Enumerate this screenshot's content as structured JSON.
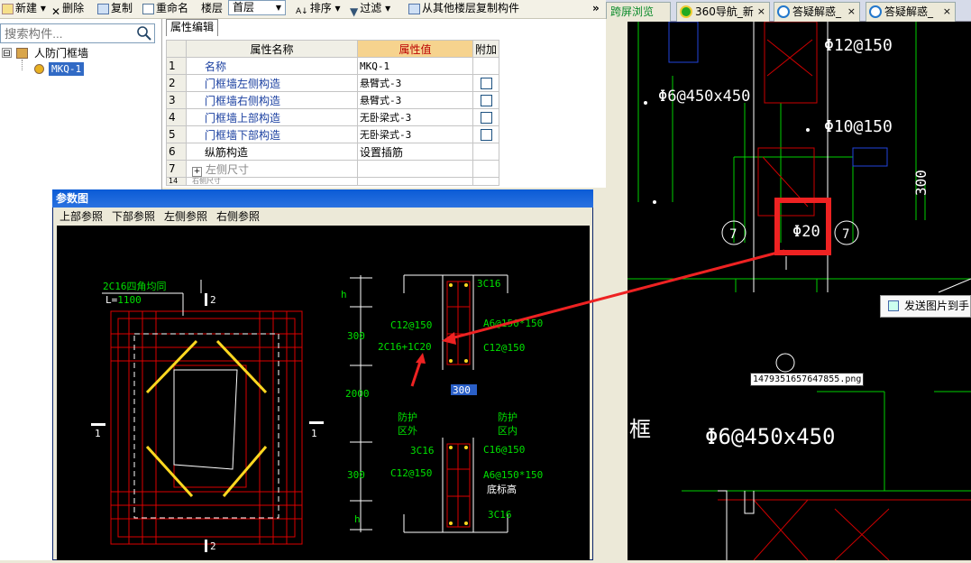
{
  "toolbar": {
    "new": "新建",
    "delete": "删除",
    "copy": "复制",
    "rename": "重命名",
    "floor_label": "楼层",
    "floor_value": "首层",
    "sort": "排序",
    "filter": "过滤",
    "copy_from_floor": "从其他楼层复制构件",
    "overflow": "»"
  },
  "tabs": [
    {
      "label": "跨屏浏览"
    },
    {
      "label": "360导航_新"
    },
    {
      "label": "答疑解惑_"
    },
    {
      "label": "答疑解惑_"
    }
  ],
  "tab_close": "×",
  "search": {
    "placeholder": "搜索构件..."
  },
  "tree": {
    "root": "人防门框墙",
    "child": "MKQ-1",
    "expand": "⊟"
  },
  "prop_panel": {
    "tab": "属性编辑",
    "headers": {
      "name": "属性名称",
      "value": "属性值",
      "extra": "附加"
    },
    "rows": [
      {
        "num": "1",
        "name": "名称",
        "value": "MKQ-1"
      },
      {
        "num": "2",
        "name": "门框墙左侧构造",
        "value": "悬臂式-3"
      },
      {
        "num": "3",
        "name": "门框墙右侧构造",
        "value": "悬臂式-3"
      },
      {
        "num": "4",
        "name": "门框墙上部构造",
        "value": "无卧梁式-3"
      },
      {
        "num": "5",
        "name": "门框墙下部构造",
        "value": "无卧梁式-3"
      },
      {
        "num": "6",
        "name": "纵筋构造",
        "value": "设置插筋"
      },
      {
        "num": "7",
        "name": "左侧尺寸",
        "value": ""
      },
      {
        "num": "14",
        "name": "右侧尺寸",
        "value": ""
      }
    ]
  },
  "dialog": {
    "title": "参数图",
    "menu": [
      "上部参照",
      "下部参照",
      "左侧参照",
      "右侧参照"
    ],
    "drawing": {
      "corner_note": "2C16四角均同",
      "length_label": "L=",
      "length_value": "1100",
      "section_marks": [
        "1",
        "1",
        "2",
        "2"
      ],
      "dims": [
        "h",
        "300",
        "2000",
        "300",
        "h"
      ],
      "rebar_top": "3C16",
      "stirrup_left_top": "C12@150",
      "stirrup_right_top": "A6@150*150",
      "main_bar": "2C16+1C20",
      "stirrup_right_mid": "C12@150",
      "wall_thickness": "300",
      "outer_label": [
        "防护",
        "区外"
      ],
      "inner_label": [
        "防护",
        "区内"
      ],
      "rebar_bottom_left": "3C16",
      "rebar_bottom_right": "C16@150",
      "stirrup_left_bot": "C12@150",
      "stirrup_right_bot": "A6@150*150",
      "base_elev": "底标高",
      "rebar_bottom": "3C16"
    }
  },
  "cad": {
    "labels": [
      "Φ12@150",
      "Φ6@450x450",
      "Φ10@150",
      "300",
      "Φ20",
      "7",
      "7",
      "Φ6@450x450",
      "框"
    ],
    "filename": "1479351657647855.png"
  },
  "popup": {
    "label": "发送图片到手"
  },
  "colors": {
    "accent": "#ff2020",
    "cad_green": "#00e000",
    "dialog_title": "#0a5bd6"
  }
}
